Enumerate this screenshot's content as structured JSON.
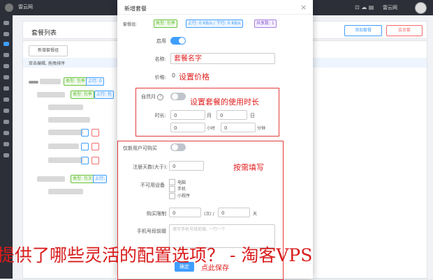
{
  "topbar": {
    "brand": "雷云网",
    "user": "雷云网",
    "right_icons": "⊡ ☁ ▤"
  },
  "page": {
    "header_title": "套餐列表",
    "btn_blue": "添加套餐",
    "btn_red": "会员套",
    "add_button": "新增套餐组",
    "hint": "双击编辑, 拖拽排序",
    "tree_tags": {
      "g1": "类型: 包季",
      "b1": "上行: 0",
      "g2": "类型: 包季",
      "b2": "上行: 包",
      "g3": "类型: 包次",
      "b3": "上行:"
    }
  },
  "modal": {
    "title": "新增套餐",
    "close": "×",
    "chips_label": "套餐组:",
    "chips": [
      "类型: 包季",
      "上行: 0 KB/s / 下行: 0 KB/s",
      "共享数: 1"
    ],
    "enable_label": "启用",
    "name_label": "名称:",
    "name_value": "套餐名字",
    "price_label": "价格:",
    "price_value": "0",
    "price_anno": "设置价格",
    "natural_month_label": "自然月",
    "duration_anno": "设置套餐的使用时长",
    "duration_label": "时长:",
    "month_value": "0",
    "month_unit": "月",
    "day_value": "0",
    "day_unit": "日",
    "hour_value": "0",
    "hour_unit": "小时",
    "minute_value": "0",
    "minute_unit": "分钟",
    "new_user_label": "仅新用户可购买",
    "fill_anno": "按需填写",
    "reg_days_label": "注册天数(大于):",
    "reg_days_value": "0",
    "devices_label": "不可用设备",
    "devices": [
      "电脑",
      "手机",
      "小程序"
    ],
    "purchase_limit_label": "购买限制",
    "purchase_times_value": "0",
    "times_unit": "(次) /",
    "purchase_days_value": "0",
    "days_unit": "天",
    "phone_label": "手机号段前缀",
    "phone_placeholder": "填写手机号段前缀, 一行一个",
    "ok_button": "确定",
    "save_hint": "点此保存"
  },
  "overlay_text": "提供了哪些灵活的配置选项？ - 淘客VPS",
  "colors": {
    "toggle_on": "#409eff",
    "toggle_off": "#c0c4cc",
    "annotation_red": "#e23b3b",
    "overlay_red": "#d81c1c"
  }
}
